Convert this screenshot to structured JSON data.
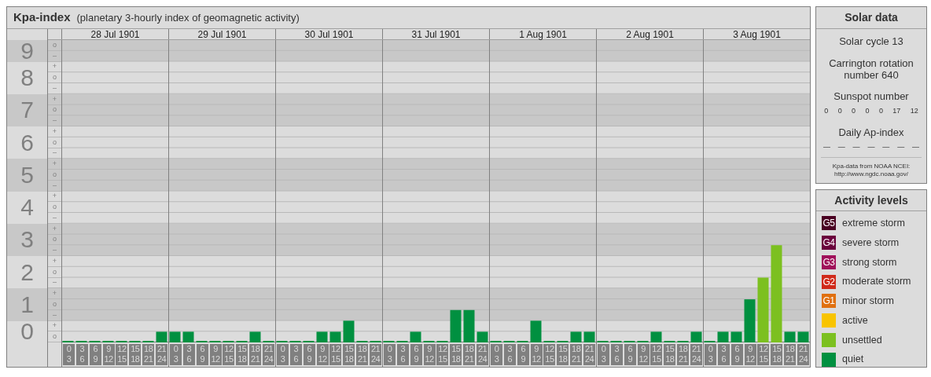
{
  "header": {
    "title": "Kpa-index",
    "subtitle": "(planetary 3-hourly index of geomagnetic activity)"
  },
  "scale": [
    {
      "minors": [
        "o",
        "–"
      ]
    },
    {
      "minors": [
        "+",
        "o",
        "–"
      ]
    },
    {
      "minors": [
        "+",
        "o",
        "–"
      ]
    },
    {
      "minors": [
        "+",
        "o",
        "–"
      ]
    },
    {
      "minors": [
        "+",
        "o",
        "–"
      ]
    },
    {
      "minors": [
        "+",
        "o",
        "–"
      ]
    },
    {
      "minors": [
        "+",
        "o",
        "–"
      ]
    },
    {
      "minors": [
        "+",
        "o",
        "–"
      ]
    },
    {
      "minors": [
        "+",
        "o",
        "–"
      ]
    },
    {
      "minors": [
        "+",
        "o"
      ]
    }
  ],
  "days": [
    {
      "label": "28 Jul 1901",
      "slots": [
        [
          "0",
          "3"
        ],
        [
          "3",
          "6"
        ],
        [
          "6",
          "9"
        ],
        [
          "9",
          "12"
        ],
        [
          "12",
          "15"
        ],
        [
          "15",
          "18"
        ],
        [
          "18",
          "21"
        ],
        [
          "21",
          "24"
        ]
      ]
    },
    {
      "label": "29 Jul 1901",
      "slots": [
        [
          "0",
          "3"
        ],
        [
          "3",
          "6"
        ],
        [
          "6",
          "9"
        ],
        [
          "9",
          "12"
        ],
        [
          "12",
          "15"
        ],
        [
          "15",
          "18"
        ],
        [
          "18",
          "21"
        ],
        [
          "21",
          "24"
        ]
      ]
    },
    {
      "label": "30 Jul 1901",
      "slots": [
        [
          "0",
          "3"
        ],
        [
          "3",
          "6"
        ],
        [
          "6",
          "9"
        ],
        [
          "9",
          "12"
        ],
        [
          "12",
          "15"
        ],
        [
          "15",
          "18"
        ],
        [
          "18",
          "21"
        ],
        [
          "21",
          "24"
        ]
      ]
    },
    {
      "label": "31 Jul 1901",
      "slots": [
        [
          "0",
          "3"
        ],
        [
          "3",
          "6"
        ],
        [
          "6",
          "9"
        ],
        [
          "9",
          "12"
        ],
        [
          "12",
          "15"
        ],
        [
          "15",
          "18"
        ],
        [
          "18",
          "21"
        ],
        [
          "21",
          "24"
        ]
      ]
    },
    {
      "label": "1 Aug 1901",
      "slots": [
        [
          "0",
          "3"
        ],
        [
          "3",
          "6"
        ],
        [
          "6",
          "9"
        ],
        [
          "9",
          "12"
        ],
        [
          "12",
          "15"
        ],
        [
          "15",
          "18"
        ],
        [
          "18",
          "21"
        ],
        [
          "21",
          "24"
        ]
      ]
    },
    {
      "label": "2 Aug 1901",
      "slots": [
        [
          "0",
          "3"
        ],
        [
          "3",
          "6"
        ],
        [
          "6",
          "9"
        ],
        [
          "9",
          "12"
        ],
        [
          "12",
          "15"
        ],
        [
          "15",
          "18"
        ],
        [
          "18",
          "21"
        ],
        [
          "21",
          "24"
        ]
      ]
    },
    {
      "label": "3 Aug 1901",
      "slots": [
        [
          "0",
          "3"
        ],
        [
          "3",
          "6"
        ],
        [
          "6",
          "9"
        ],
        [
          "9",
          "12"
        ],
        [
          "12",
          "15"
        ],
        [
          "15",
          "18"
        ],
        [
          "18",
          "21"
        ],
        [
          "21",
          "24"
        ]
      ]
    }
  ],
  "chart_data": {
    "type": "bar",
    "stacked": true,
    "grid": true,
    "ylim": [
      0,
      9.33
    ],
    "yticks": [
      0,
      1,
      2,
      3,
      4,
      5,
      6,
      7,
      8,
      9
    ],
    "series": [
      {
        "color": "#009040",
        "values": [
          0,
          0,
          0,
          0,
          0,
          0,
          0,
          0.33,
          0.33,
          0.33,
          0,
          0,
          0,
          0,
          0.33,
          0,
          0,
          0,
          0,
          0.33,
          0.33,
          0.67,
          0,
          0,
          0,
          0,
          0.33,
          0,
          0,
          1,
          1,
          0.33,
          0,
          0,
          0,
          0.67,
          0,
          0,
          0.33,
          0.33,
          0,
          0,
          0,
          0,
          0.33,
          0,
          0,
          0.33,
          0,
          0.33,
          0.33,
          1.33,
          null,
          null,
          0.33,
          0.33
        ]
      },
      {
        "color": "#7cc020",
        "values": [
          null,
          null,
          null,
          null,
          null,
          null,
          null,
          null,
          null,
          null,
          null,
          null,
          null,
          null,
          null,
          null,
          null,
          null,
          null,
          null,
          null,
          null,
          null,
          null,
          null,
          null,
          null,
          null,
          null,
          null,
          null,
          null,
          null,
          null,
          null,
          null,
          null,
          null,
          null,
          null,
          null,
          null,
          null,
          null,
          null,
          null,
          null,
          null,
          null,
          null,
          null,
          null,
          2,
          3,
          null,
          null
        ]
      }
    ]
  },
  "solar": {
    "title": "Solar data",
    "cycle": "Solar cycle 13",
    "rotation": "Carrington rotation number 640",
    "sunspot_label": "Sunspot number",
    "sunspots": [
      "0",
      "0",
      "0",
      "0",
      "0",
      "17",
      "12"
    ],
    "ap_label": "Daily Ap-index",
    "ap_values": [
      "—",
      "—",
      "—",
      "—",
      "—",
      "—",
      "—"
    ],
    "source": [
      "Kpa-data from NOAA NCEI:",
      "http://www.ngdc.noaa.gov/"
    ]
  },
  "legend": {
    "title": "Activity levels",
    "items": [
      {
        "badge": "G5",
        "label": "extreme storm",
        "color": "#4a0022"
      },
      {
        "badge": "G4",
        "label": "severe storm",
        "color": "#6a003c"
      },
      {
        "badge": "G3",
        "label": "strong storm",
        "color": "#a0105a"
      },
      {
        "badge": "G2",
        "label": "moderate storm",
        "color": "#d02a1a"
      },
      {
        "badge": "G1",
        "label": "minor storm",
        "color": "#e07010"
      },
      {
        "label": "active",
        "color": "#f8c400"
      },
      {
        "label": "unsettled",
        "color": "#7cc020"
      },
      {
        "label": "quiet",
        "color": "#009040"
      }
    ]
  }
}
